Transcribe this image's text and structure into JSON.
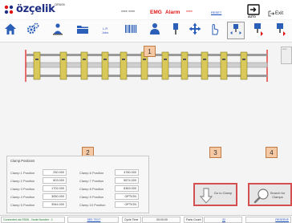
{
  "header": {
    "brand": "özçelik",
    "machine_code": "OR005",
    "status_stars_left": "**** ****",
    "status_emg": "EMG",
    "status_alarm": "Alarm",
    "status_stars_right": "****",
    "reset_link": "RESET",
    "auto_label": "AUTO",
    "exit_label": "Exit"
  },
  "toolbar": {
    "lift_jobs_label_1": "L-R",
    "lift_jobs_label_2": "Jobs"
  },
  "side_panel_text": "Loco",
  "callouts": [
    "1",
    "2",
    "3",
    "4"
  ],
  "clamp_positions": {
    "title": "Clamp Positions",
    "left": [
      {
        "label": "Clamp 1 Position",
        "value": "250.000"
      },
      {
        "label": "Clamp 2 Position",
        "value": "803.000"
      },
      {
        "label": "Clamp 3 Position",
        "value": "1702.000"
      },
      {
        "label": "Clamp 4 Position",
        "value": "3050.000"
      },
      {
        "label": "Clamp 5 Position",
        "value": "3944.000"
      }
    ],
    "right": [
      {
        "label": "Clamp 6 Position",
        "value": "4780.000"
      },
      {
        "label": "Clamp 7 Position",
        "value": "5574.000"
      },
      {
        "label": "Clamp 8 Position",
        "value": "6363.000"
      },
      {
        "label": "Clamp 9 Position",
        "value": "OPTION"
      },
      {
        "label": "Clamp 10 Position",
        "value": "OPTION"
      }
    ]
  },
  "actions": {
    "go_to_clamp": "Go to Clamp",
    "search_for_clamps": "Search for Clamps"
  },
  "statusbar": {
    "connection": "Connected via RS06 - Node Number : 1",
    "link1": "SEE TEXT",
    "cycle_time_label": "Cycle Time",
    "cycle_time_value": "00:00:00",
    "parts_count_label": "Parts Count",
    "parts_count_value": "32",
    "link2": "RESERVE"
  },
  "colors": {
    "brand_blue": "#1f2f86",
    "alarm_red": "#e01414",
    "clamp_yellow": "#d8c95a",
    "rail_gray": "#8a8a8a",
    "callout_orange": "#f6c9a5"
  }
}
